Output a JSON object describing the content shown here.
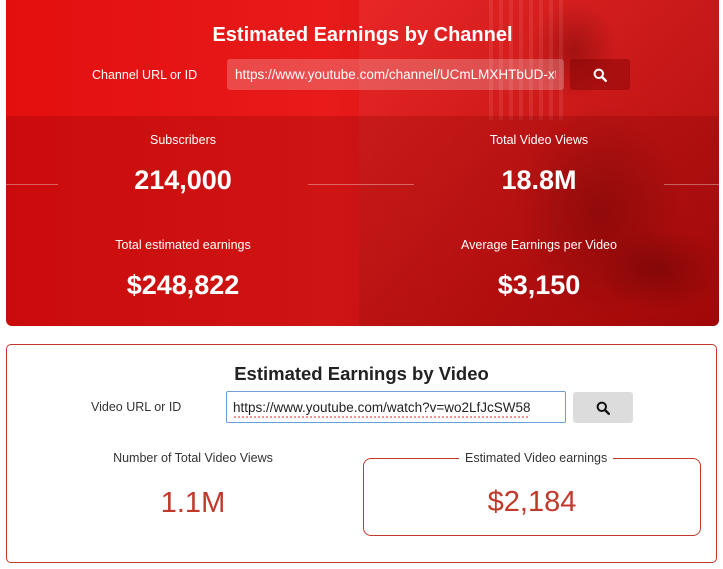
{
  "channel": {
    "title": "Estimated Earnings by Channel",
    "url_label": "Channel URL or ID",
    "url_value": "https://www.youtube.com/channel/UCmLMXHTbUD-xtl",
    "search_icon": "search-icon",
    "stats": {
      "subscribers_label": "Subscribers",
      "subscribers_value": "214,000",
      "views_label": "Total Video Views",
      "views_value": "18.8M",
      "earnings_label": "Total estimated earnings",
      "earnings_value": "$248,822",
      "avg_label": "Average Earnings per Video",
      "avg_value": "$3,150"
    }
  },
  "video": {
    "title": "Estimated Earnings by Video",
    "url_label": "Video URL or ID",
    "url_value": "https://www.youtube.com/watch?v=wo2LfJcSW58",
    "search_icon": "search-icon",
    "views_label": "Number of Total Video Views",
    "views_value": "1.1M",
    "earnings_label": "Estimated Video earnings",
    "earnings_value": "$2,184"
  },
  "colors": {
    "brand_red": "#e30f0f",
    "accent_red": "#c0392b"
  }
}
